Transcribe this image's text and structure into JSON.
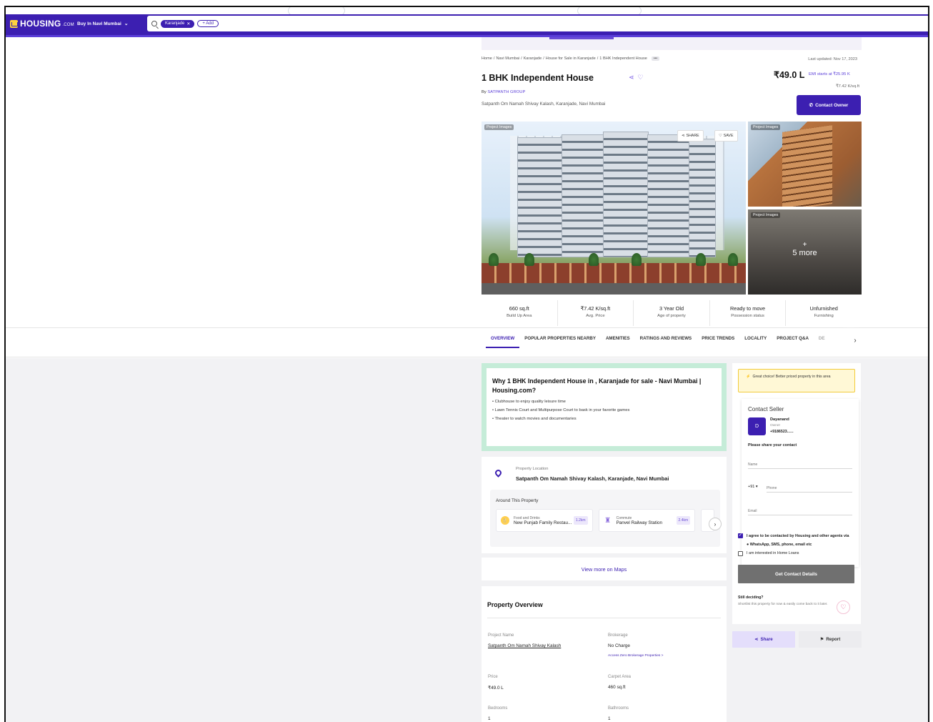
{
  "header": {
    "logo_text": "HOUSING",
    "logo_suffix": ".COM",
    "buy_dropdown": "Buy In Navi Mumbai",
    "search_chip": "Karanjade",
    "add_chip": "+ Add"
  },
  "listing": {
    "breadcrumb": [
      "Home",
      "Navi Mumbai",
      "Karanjade",
      "House for Sale in Karanjade",
      "1 BHK Independent House"
    ],
    "breadcrumb_more": "•••",
    "last_updated": "Last updated: Nov 17, 2023",
    "title": "1 BHK Independent House",
    "by_prefix": "By",
    "builder": "SATPANTH GROUP",
    "address": "Satpanth Om Namah Shivay Kalash, Karanjade, Navi Mumbai",
    "price": "₹49.0 L",
    "emi": "EMI starts at ₹25.95 K",
    "price_per_sqft": "₹7.42 K/sq.ft",
    "contact_owner": "Contact Owner"
  },
  "gallery": {
    "main_label": "Project Images",
    "share_label": "SHARE",
    "save_label": "SAVE",
    "side1_label": "Project Images",
    "side2_label": "Project Images",
    "more_label": "5 more"
  },
  "facts": [
    {
      "value": "660 sq.ft",
      "label": "Build Up Area"
    },
    {
      "value": "₹7.42 K/sq.ft",
      "label": "Avg. Price"
    },
    {
      "value": "3 Year Old",
      "label": "Age of property"
    },
    {
      "value": "Ready to move",
      "label": "Possession status"
    },
    {
      "value": "Unfurnished",
      "label": "Furnishing"
    }
  ],
  "tabs": [
    "OVERVIEW",
    "POPULAR PROPERTIES NEARBY",
    "AMENITIES",
    "RATINGS AND REVIEWS",
    "PRICE TRENDS",
    "LOCALITY",
    "PROJECT Q&A",
    "DE"
  ],
  "why": {
    "heading": "Why 1 BHK Independent House in , Karanjade for sale - Navi Mumbai | Housing.com?",
    "points": [
      "• Clubhouse to enjoy quality leisure time",
      "• Lawn Tennis Court and Multipurpose Court to bask in your favorite games",
      "• Theater to watch movies and documentaries"
    ]
  },
  "location": {
    "label": "Property Location",
    "value": "Satpanth Om Namah Shivay Kalash, Karanjade, Navi Mumbai",
    "around_heading": "Around This Property",
    "pois": [
      {
        "type": "Food and Drinks",
        "name": "New Punjab Family Restau...",
        "distance": "1.2km"
      },
      {
        "type": "Commute",
        "name": "Panvel Railway Station",
        "distance": "2.4km"
      }
    ],
    "view_maps": "View more on Maps"
  },
  "overview": {
    "heading": "Property Overview",
    "items": [
      {
        "label": "Project Name",
        "value": "Satpanth Om Namah Shivay Kalash"
      },
      {
        "label": "Brokerage",
        "value": "No Charge",
        "link": "Access Zero Brokerage Properties >"
      },
      {
        "label": "Price",
        "value": "₹49.0 L"
      },
      {
        "label": "Carpet Area",
        "value": "460 sq.ft"
      },
      {
        "label": "Bedrooms",
        "value": "1"
      },
      {
        "label": "Bathrooms",
        "value": "1"
      }
    ]
  },
  "sidebar": {
    "choice_text": "Great choice! Better priced property in this area",
    "contact_heading": "Contact Seller",
    "agent_initial": "D",
    "agent_name": "Dayanand",
    "agent_role": "Owner",
    "agent_phone": "+9186523......",
    "share_contact": "Please share your contact",
    "name_placeholder": "Name",
    "country_code": "+91 ▾",
    "phone_placeholder": "Phone",
    "email_placeholder": "Email",
    "agree_text": "I agree to be contacted by Housing and other agents via",
    "agree_text2": "WhatsApp, SMS, phone, email etc",
    "loans_text": "I am interested in Home Loans",
    "get_contact": "Get Contact Details",
    "still_deciding": "Still deciding?",
    "still_sub": "Shortlist this property for now & easily come back to it later.",
    "share_label": "Share",
    "report_label": "Report"
  },
  "colors": {
    "brand": "#3c1fb1",
    "accent": "#5b3fd8",
    "why_bg": "#c5ecd8"
  }
}
